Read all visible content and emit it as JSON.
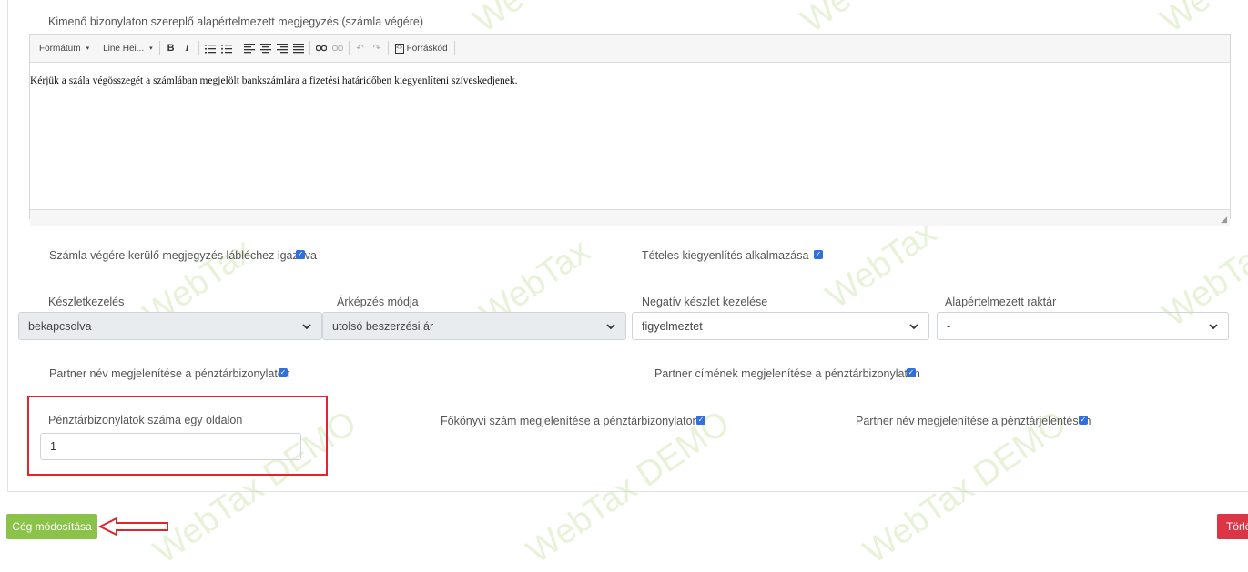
{
  "editor": {
    "label": "Kimenő bizonylaton szereplő alapértelmezett megjegyzés (számla végére)",
    "toolbar": {
      "format_label": "Formátum",
      "lineheight_label": "Line Hei...",
      "source_label": "Forráskód"
    },
    "content": "Kérjük a szála végösszegét a számlában megjelölt bankszámlára a fizetési határidőben kiegyenlíteni szíveskedjenek."
  },
  "options1": {
    "footer_aligned_label": "Számla végére kerülő megjegyzés lábléchez igazítva",
    "footer_aligned_checked": true,
    "itemized_settlement_label": "Tételes kiegyenlítés alkalmazása",
    "itemized_settlement_checked": true
  },
  "selects": [
    {
      "label": "Készletkezelés",
      "value": "bekapcsolva"
    },
    {
      "label": "Árképzés módja",
      "value": "utolsó beszerzési ár"
    },
    {
      "label": "Negatív készlet kezelése",
      "value": "figyelmeztet"
    },
    {
      "label": "Alapértelmezett raktár",
      "value": "-"
    }
  ],
  "options2": {
    "partner_name_cash_label": "Partner név megjelenítése a pénztárbizonylaton",
    "partner_address_cash_label": "Partner címének megjelenítése a pénztárbizonylaton"
  },
  "options3": {
    "docs_per_page_label": "Pénztárbizonylatok száma egy oldalon",
    "docs_per_page_value": "1",
    "ledger_number_label": "Főkönyvi szám megjelenítése a pénztárbizonylaton",
    "partner_name_report_label": "Partner név megjelenítése a pénztárjelentésen"
  },
  "buttons": {
    "save": "Cég módosítása",
    "delete": "Törlé"
  },
  "watermark": {
    "main": "WebTax",
    "demo": "WebTax DEMO",
    "short": "We"
  },
  "colors": {
    "accent": "#8bc34a",
    "danger": "#dc3545",
    "highlight": "#e0262b",
    "checkbox": "#2f6fe0"
  }
}
